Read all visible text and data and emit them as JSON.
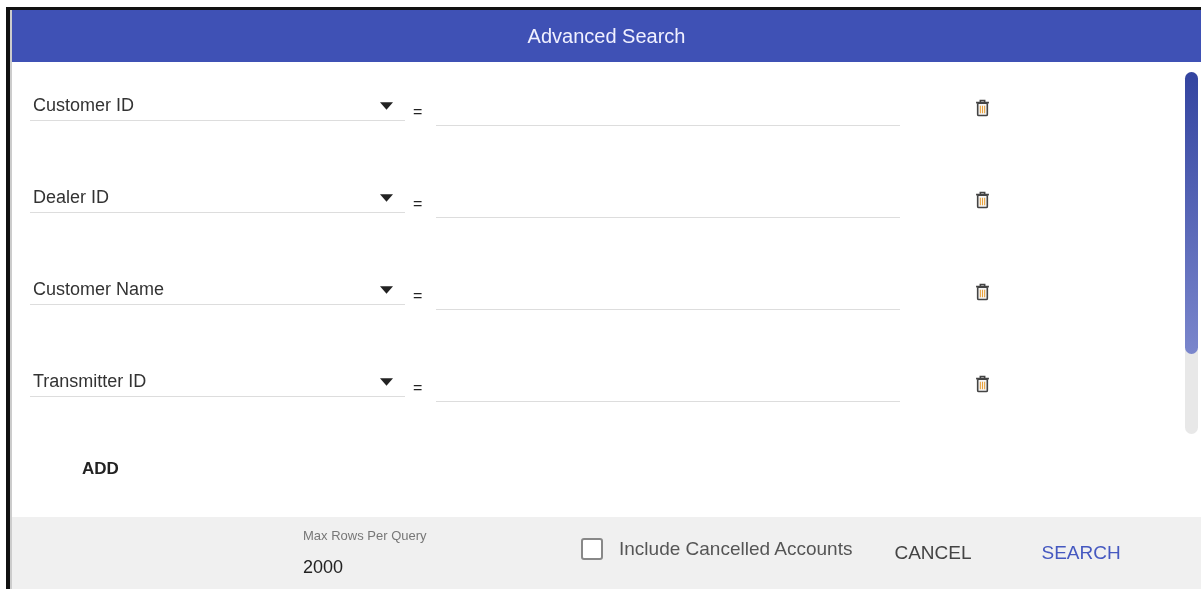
{
  "dialog": {
    "title": "Advanced Search"
  },
  "criteria": [
    {
      "field": "Customer ID",
      "operator": "="
    },
    {
      "field": "Dealer ID",
      "operator": "="
    },
    {
      "field": "Customer Name",
      "operator": "="
    },
    {
      "field": "Transmitter ID",
      "operator": "="
    }
  ],
  "add_button": "ADD",
  "footer": {
    "max_rows": {
      "label": "Max Rows Per Query",
      "value": "2000"
    },
    "include_cancelled": {
      "label": "Include Cancelled Accounts",
      "checked": false
    },
    "buttons": [
      {
        "label": "CANCEL",
        "kind": "secondary"
      },
      {
        "label": "SEARCH",
        "kind": "primary"
      }
    ]
  }
}
